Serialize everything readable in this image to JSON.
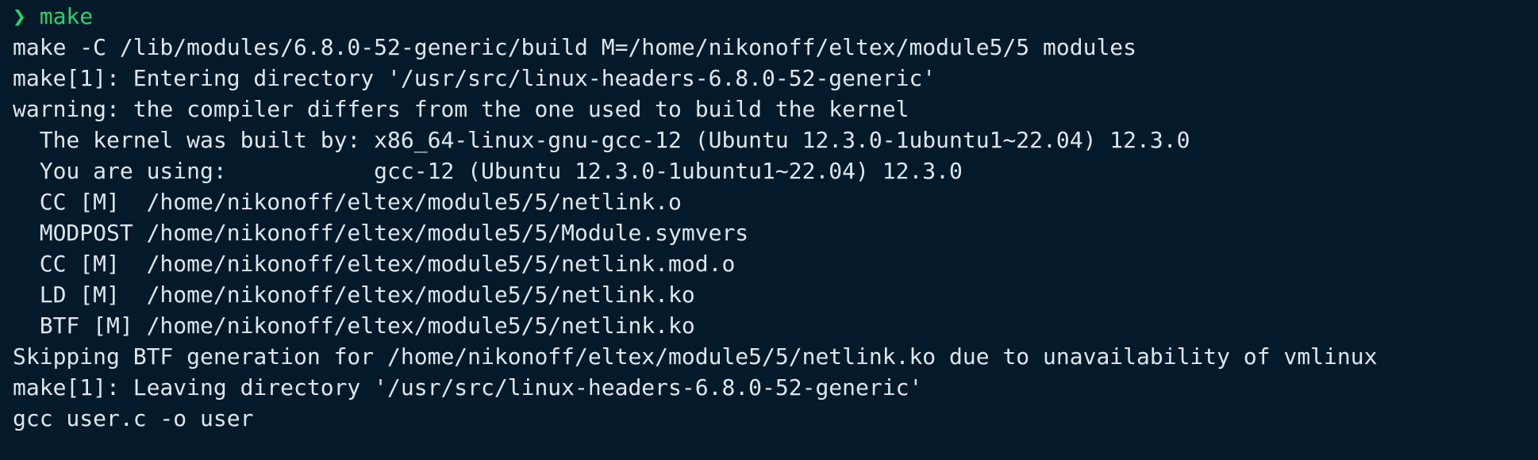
{
  "terminal": {
    "prompt": {
      "symbol": "❯",
      "command": "make"
    },
    "output_lines": [
      "make -C /lib/modules/6.8.0-52-generic/build M=/home/nikonoff/eltex/module5/5 modules",
      "make[1]: Entering directory '/usr/src/linux-headers-6.8.0-52-generic'",
      "warning: the compiler differs from the one used to build the kernel",
      "  The kernel was built by: x86_64-linux-gnu-gcc-12 (Ubuntu 12.3.0-1ubuntu1~22.04) 12.3.0",
      "  You are using:           gcc-12 (Ubuntu 12.3.0-1ubuntu1~22.04) 12.3.0",
      "  CC [M]  /home/nikonoff/eltex/module5/5/netlink.o",
      "  MODPOST /home/nikonoff/eltex/module5/5/Module.symvers",
      "  CC [M]  /home/nikonoff/eltex/module5/5/netlink.mod.o",
      "  LD [M]  /home/nikonoff/eltex/module5/5/netlink.ko",
      "  BTF [M] /home/nikonoff/eltex/module5/5/netlink.ko",
      "Skipping BTF generation for /home/nikonoff/eltex/module5/5/netlink.ko due to unavailability of vmlinux",
      "make[1]: Leaving directory '/usr/src/linux-headers-6.8.0-52-generic'",
      "gcc user.c -o user"
    ],
    "colors": {
      "background": "#041a2b",
      "text": "#dfe6ec",
      "prompt": "#28d46a"
    }
  }
}
